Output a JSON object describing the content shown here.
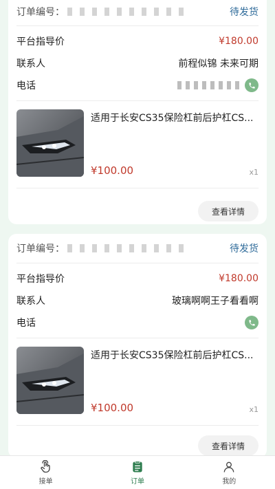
{
  "orders": [
    {
      "order_label": "订单编号：",
      "status": "待发货",
      "guide_price_label": "平台指导价",
      "guide_price": "¥180.00",
      "contact_label": "联系人",
      "contact": "前程似锦 未来可期",
      "phone_label": "电话",
      "product_title": "适用于长安CS35保险杠前后护杠CS...",
      "product_price": "¥100.00",
      "quantity": "x1",
      "details_button": "查看详情"
    },
    {
      "order_label": "订单编号：",
      "status": "待发货",
      "guide_price_label": "平台指导价",
      "guide_price": "¥180.00",
      "contact_label": "联系人",
      "contact": "玻璃啊啊王子看看啊",
      "phone_label": "电话",
      "product_title": "适用于长安CS35保险杠前后护杠CS...",
      "product_price": "¥100.00",
      "quantity": "x1",
      "details_button": "查看详情"
    }
  ],
  "tabbar": {
    "items": [
      {
        "label": "接单",
        "icon": "hand-tap-icon",
        "active": false
      },
      {
        "label": "订单",
        "icon": "clipboard-icon",
        "active": true
      },
      {
        "label": "我的",
        "icon": "user-icon",
        "active": false
      }
    ]
  },
  "colors": {
    "accent": "#2e7d4f",
    "price": "#c0392b",
    "status": "#2f6b9a",
    "background": "#eef7f1"
  }
}
